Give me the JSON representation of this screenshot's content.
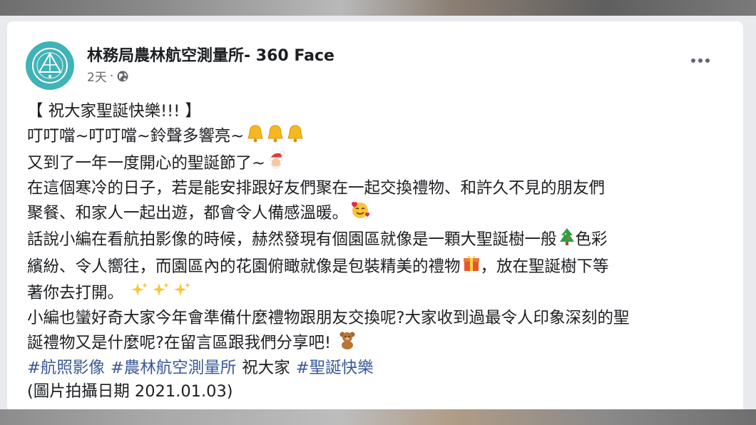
{
  "post": {
    "author": "林務局農林航空測量所- 360 Face",
    "time": "2天",
    "dot_sep": "·",
    "lines": [
      "【 祝大家聖誕快樂!!! 】",
      "叮叮噹~叮叮噹~鈴聲多響亮~",
      "又到了一年一度開心的聖誕節了~",
      "在這個寒冷的日子，若是能安排跟好友們聚在一起交換禮物、和許久不見的朋友們",
      "聚餐、和家人一起出遊，都會令人備感溫暖。",
      "話說小編在看航拍影像的時候，赫然發現有個園區就像是一顆大聖誕樹一般",
      "色彩",
      "繽紛、令人嚮往，而園區內的花園俯瞰就像是包裝精美的禮物",
      "，放在聖誕樹下等",
      "著你去打開。",
      "小編也蠻好奇大家今年會準備什麼禮物跟朋友交換呢?大家收到過最令人印象深刻的聖",
      "誕禮物又是什麼呢?在留言區跟我們分享吧!"
    ],
    "hashtags": [
      "#航照影像",
      "#農林航空測量所",
      "#聖誕快樂"
    ],
    "plain_between": "祝大家",
    "date_note": "(圖片拍攝日期 2021.01.03)"
  },
  "icons": {
    "avatar": "forestry-logo-icon",
    "privacy": "globe-icon",
    "more": "more-options-icon",
    "bell": "bell-emoji",
    "santa": "santa-emoji",
    "smile": "smiling-face-hearts-emoji",
    "tree": "christmas-tree-emoji",
    "gift": "gift-emoji",
    "sparkles": "sparkles-emoji",
    "bear": "teddy-bear-emoji"
  },
  "colors": {
    "avatar_bg": "#3fb3b8",
    "hashtag": "#385898",
    "text": "#1c1e21",
    "meta": "#65676b"
  }
}
